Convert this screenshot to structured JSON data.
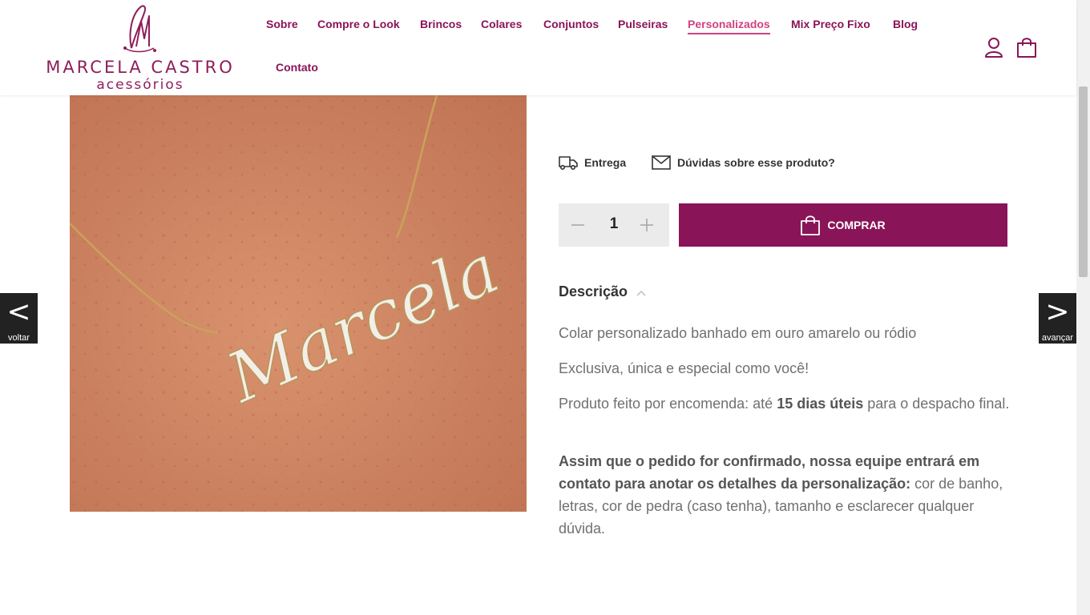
{
  "brand": {
    "name": "MARCELA CASTRO",
    "tagline": "acessórios"
  },
  "nav": {
    "items": [
      {
        "label": "Sobre"
      },
      {
        "label": "Compre o Look"
      },
      {
        "label": "Brincos"
      },
      {
        "label": "Colares"
      },
      {
        "label": "Conjuntos"
      },
      {
        "label": "Pulseiras"
      },
      {
        "label": "Personalizados",
        "active": true
      },
      {
        "label": "Mix Preço Fixo"
      },
      {
        "label": "Blog"
      },
      {
        "label": "Contato"
      }
    ]
  },
  "header_icons": [
    "user-icon",
    "shopping-bag-icon"
  ],
  "gallery": {
    "prev_label": "voltar",
    "next_label": "avançar",
    "prev_glyph": "<",
    "next_glyph": ">",
    "image_text": "Marcela"
  },
  "product": {
    "shipping_label": "Entrega",
    "questions_label": "Dúvidas sobre esse produto?",
    "quantity": "1",
    "buy_label": "COMPRAR",
    "description_title": "Descrição",
    "description": {
      "p1": "Colar personalizado banhado em ouro amarelo ou ródio",
      "p2": "Exclusiva, única e especial como você!",
      "p3_before": "Produto feito por encomenda: até ",
      "p3_bold": "15 dias úteis",
      "p3_after": " para o despacho final.",
      "p4_bold": "Assim que o pedido for confirmado, nossa equipe entrará em contato para anotar os detalhes da personalização:",
      "p4_after": " cor de banho, letras, cor de pedra (caso tenha), tamanho e esclarecer qualquer dúvida."
    }
  },
  "colors": {
    "brand": "#8a1458",
    "nav_active": "#d0427f",
    "text_body": "#707070"
  }
}
